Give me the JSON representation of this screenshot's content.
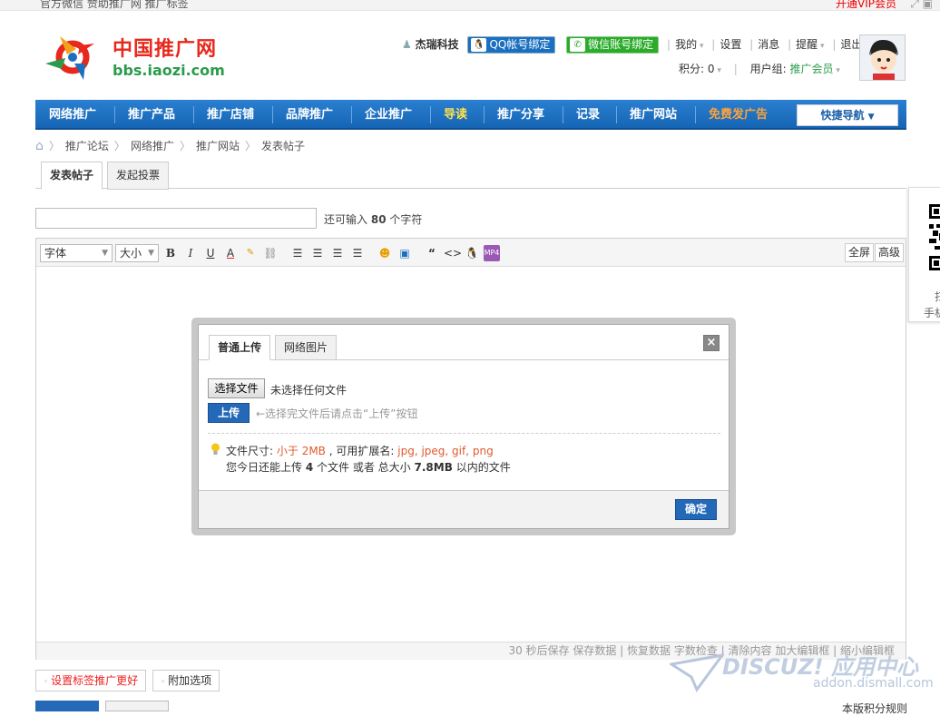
{
  "topbar": {
    "left": "官方微信 赞助推广网 推广标签",
    "right": "开通VIP会员"
  },
  "logo": {
    "cn": "中国推广网",
    "en": "bbs.iaozi.com"
  },
  "usermenu": {
    "username": "杰瑞科技",
    "qq_bind": "QQ帐号绑定",
    "wechat_bind": "微信账号绑定",
    "links": [
      "我的",
      "设置",
      "消息",
      "提醒",
      "退出"
    ],
    "points_label": "积分: 0",
    "group_label": "用户组:",
    "group_value": "推广会员"
  },
  "nav": {
    "items": [
      "网络推广",
      "推广产品",
      "推广店铺",
      "品牌推广",
      "企业推广",
      "导读",
      "推广分享",
      "记录",
      "推广网站",
      "免费发广告"
    ],
    "quick": "快捷导航"
  },
  "breadcrumb": [
    "推广论坛",
    "网络推广",
    "推广网站",
    "发表帖子"
  ],
  "tabs": {
    "post": "发表帖子",
    "poll": "发起投票"
  },
  "subject": {
    "remain_prefix": "还可输入",
    "remain_count": "80",
    "remain_suffix": "个字符"
  },
  "toolbar": {
    "font": "字体",
    "size": "大小",
    "fullscreen": "全屏",
    "advanced": "高级"
  },
  "editor_status": "30 秒后保存 保存数据 | 恢复数据 字数检查 | 清除内容 加大编辑框 | 缩小编辑框",
  "dialog": {
    "tab_upload": "普通上传",
    "tab_web": "网络图片",
    "choose_file": "选择文件",
    "no_file": "未选择任何文件",
    "upload": "上传",
    "upload_hint": "←选择完文件后请点击“上传”按钮",
    "size_label": "文件尺寸:",
    "size_value": "小于 2MB",
    "ext_label": ", 可用扩展名:",
    "ext_value": "jpg, jpeg, gif, png",
    "today_prefix": "您今日还能上传",
    "today_count": "4",
    "today_mid": "个文件 或者 总大小",
    "today_size": "7.8MB",
    "today_suffix": "以内的文件",
    "ok": "确定"
  },
  "qr_side": {
    "line1": "扫",
    "line2": "手机"
  },
  "bottom": {
    "tags": "设置标签推广更好",
    "extra": "附加选项",
    "right": "本版积分规则"
  },
  "watermark": {
    "brand": "DISCUZ! 应用中心",
    "url": "addon.dismall.com"
  }
}
